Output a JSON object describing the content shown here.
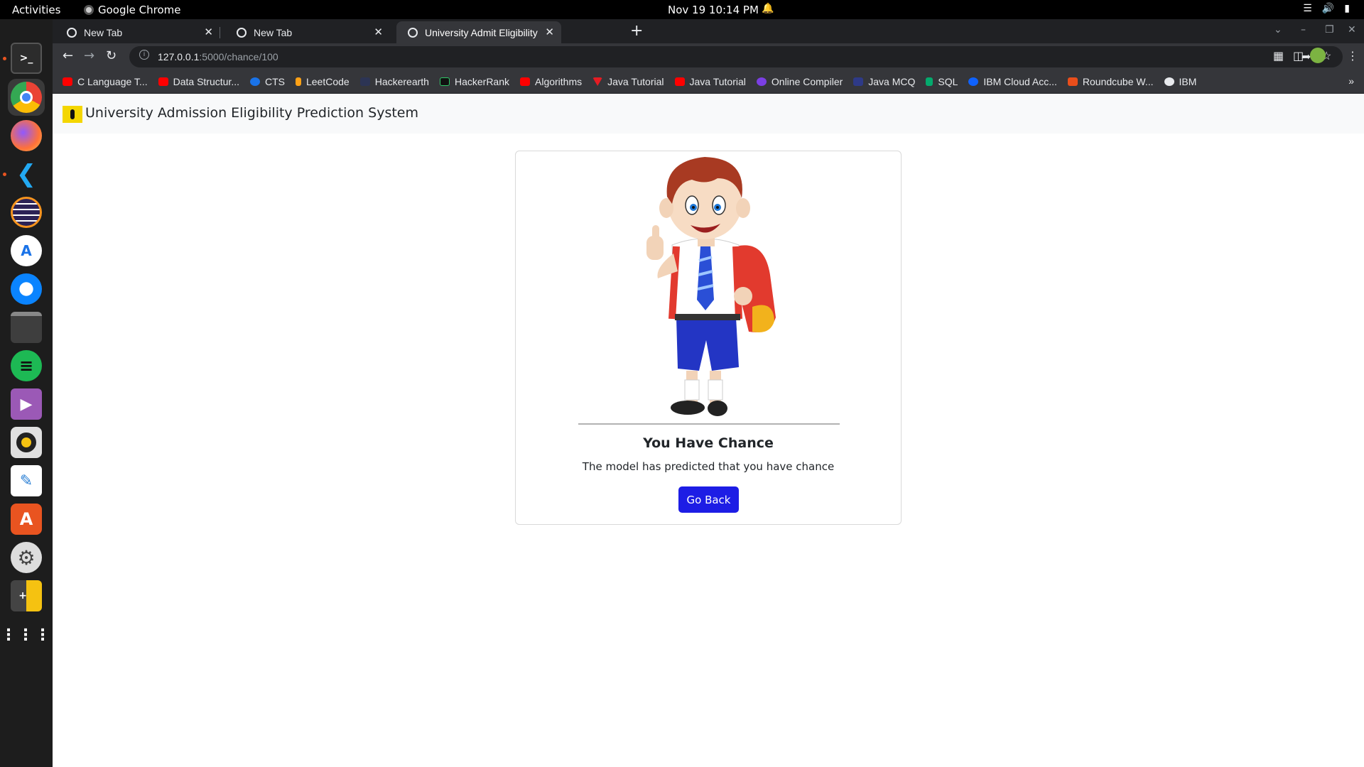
{
  "system": {
    "activities": "Activities",
    "app_name": "Google Chrome",
    "clock": "Nov 19  10:14 PM"
  },
  "dock": {
    "items": [
      {
        "name": "terminal",
        "color": "#2c2c2c"
      },
      {
        "name": "chrome",
        "color": "#4285f4"
      },
      {
        "name": "firefox",
        "color": "#ff7139"
      },
      {
        "name": "vscode",
        "color": "#007acc"
      },
      {
        "name": "eclipse",
        "color": "#2c2255"
      },
      {
        "name": "android-studio",
        "color": "#3ddc84"
      },
      {
        "name": "thunderbird",
        "color": "#0a84ff"
      },
      {
        "name": "files",
        "color": "#3e3e3e"
      },
      {
        "name": "spotify",
        "color": "#1db954"
      },
      {
        "name": "media-player",
        "color": "#9b59b6"
      },
      {
        "name": "rhythmbox",
        "color": "#f5c211"
      },
      {
        "name": "text-editor",
        "color": "#2a7fd4"
      },
      {
        "name": "app-center",
        "color": "#e95420"
      },
      {
        "name": "settings",
        "color": "#666666"
      },
      {
        "name": "calculator",
        "color": "#444444"
      },
      {
        "name": "show-apps",
        "color": "#1d1d1d"
      }
    ]
  },
  "browser": {
    "tabs": [
      {
        "label": "New Tab",
        "active": false
      },
      {
        "label": "New Tab",
        "active": false
      },
      {
        "label": "University Admit Eligibility",
        "active": true
      }
    ],
    "url_host": "127.0.0.1",
    "url_path": ":5000/chance/100",
    "bookmarks": [
      {
        "label": "C Language T...",
        "color": "#ff0000"
      },
      {
        "label": "Data Structur...",
        "color": "#ff0000"
      },
      {
        "label": "CTS",
        "color": "#1a73e8"
      },
      {
        "label": "LeetCode",
        "color": "#ffa116"
      },
      {
        "label": "Hackerearth",
        "color": "#2c3454"
      },
      {
        "label": "HackerRank",
        "color": "#111111"
      },
      {
        "label": "Algorithms",
        "color": "#ff0000"
      },
      {
        "label": "Java Tutorial",
        "color": "#e51c23"
      },
      {
        "label": "Java Tutorial",
        "color": "#ff0000"
      },
      {
        "label": "Online Compiler",
        "color": "#7b3fe4"
      },
      {
        "label": "Java MCQ",
        "color": "#2e3a87"
      },
      {
        "label": "SQL",
        "color": "#04aa6d"
      },
      {
        "label": "IBM Cloud Acc...",
        "color": "#0f62fe"
      },
      {
        "label": "Roundcube W...",
        "color": "#e94e1b"
      },
      {
        "label": "IBM",
        "color": "#e8eaed"
      }
    ],
    "bookmarks_more": "»"
  },
  "page": {
    "brand": "University Admission Eligibility Prediction System",
    "card_title": "You Have Chance",
    "card_text": "The model has predicted that you have chance",
    "button_label": "Go Back"
  }
}
